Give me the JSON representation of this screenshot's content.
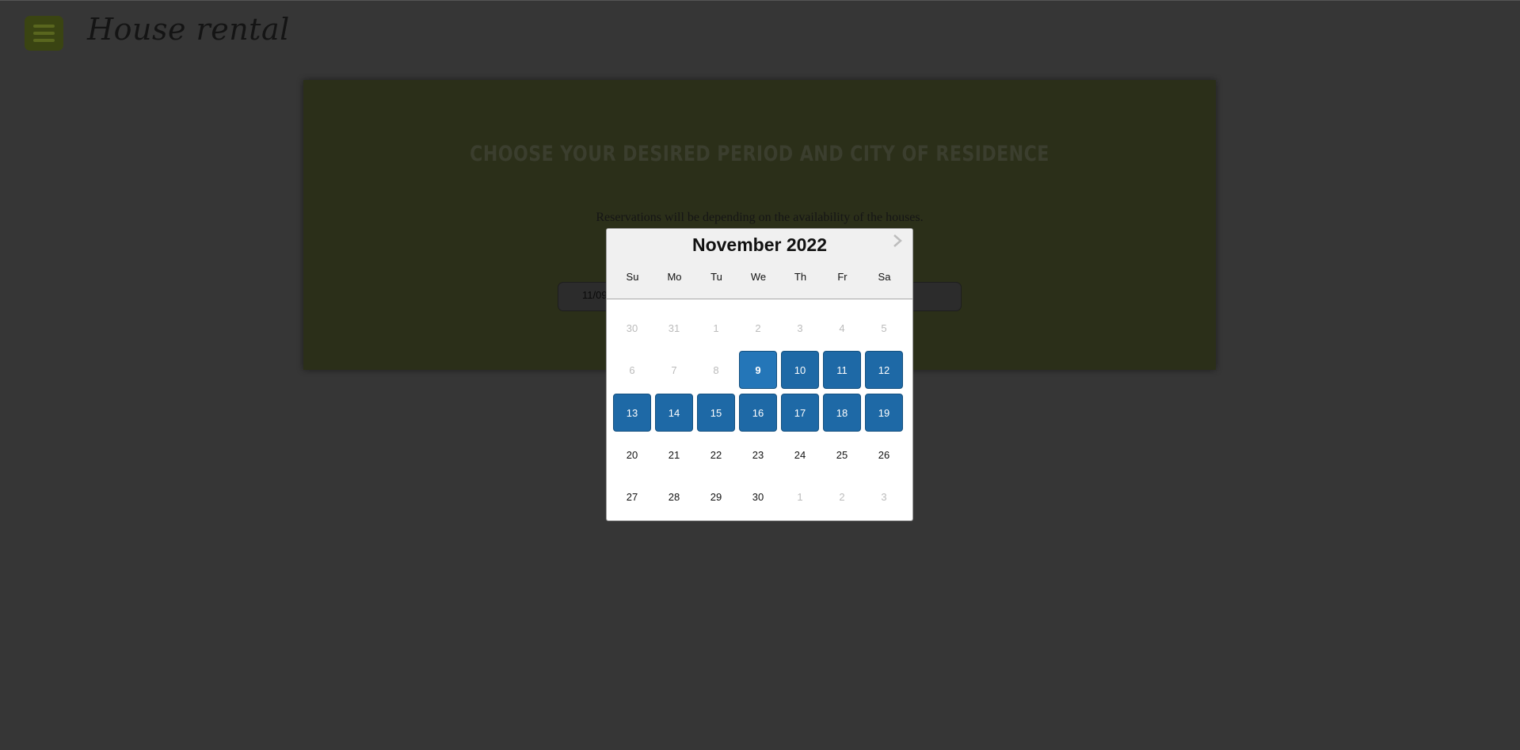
{
  "header": {
    "brand": "House rental",
    "menu_icon": "hamburger-menu-icon"
  },
  "search_panel": {
    "title": "Choose your desired period and city of residence",
    "subtitle": "Reservations will be depending on the availability of the houses.",
    "date_input_value": "11/09"
  },
  "calendar": {
    "month_title": "November 2022",
    "next_icon": "chevron-right-icon",
    "weekdays": [
      "Su",
      "Mo",
      "Tu",
      "We",
      "Th",
      "Fr",
      "Sa"
    ],
    "weeks": [
      [
        "30",
        "31",
        "1",
        "2",
        "3",
        "4",
        "5"
      ],
      [
        "6",
        "7",
        "8",
        "9",
        "10",
        "11",
        "12"
      ],
      [
        "13",
        "14",
        "15",
        "16",
        "17",
        "18",
        "19"
      ],
      [
        "20",
        "21",
        "22",
        "23",
        "24",
        "25",
        "26"
      ],
      [
        "27",
        "28",
        "29",
        "30",
        "1",
        "2",
        "3"
      ]
    ],
    "selected_range": [
      "9",
      "19"
    ],
    "colors": {
      "range": "#1e69a6",
      "overlay": "#363636",
      "panel": "#2b2f19"
    }
  }
}
